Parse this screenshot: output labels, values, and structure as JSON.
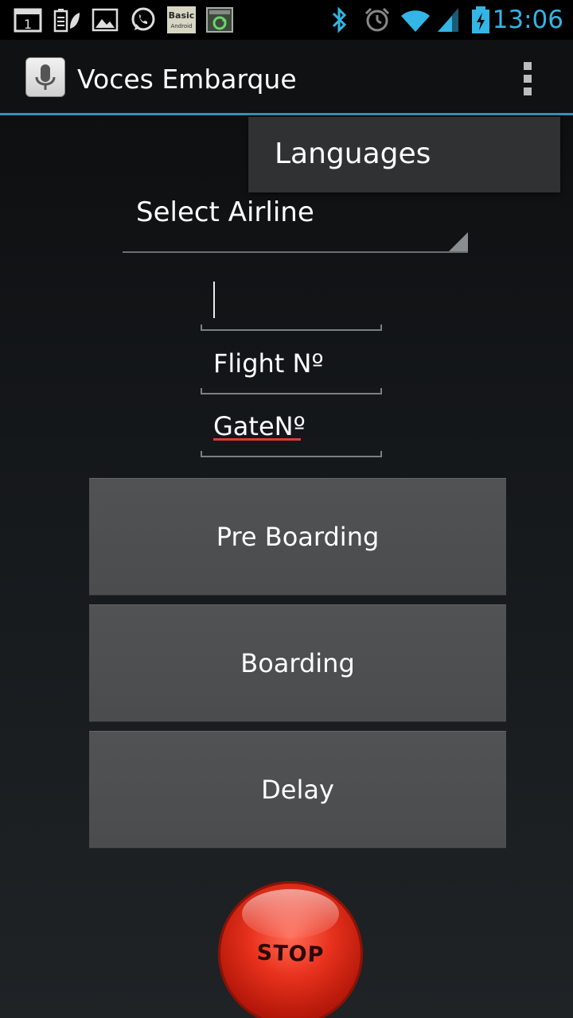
{
  "status_bar": {
    "time": "13:06",
    "left_icons": [
      "calendar-notification-icon",
      "battery-eco-icon",
      "gallery-icon",
      "whatsapp-icon",
      "basic4android-icon",
      "app-update-icon"
    ],
    "badge_calendar": "1",
    "badge_basic_line1": "Basic",
    "badge_basic_line2": "Android",
    "right_icons": [
      "bluetooth-icon",
      "alarm-icon",
      "wifi-icon",
      "signal-icon",
      "battery-charging-icon"
    ],
    "accent_color": "#33b5e5"
  },
  "action_bar": {
    "title": "Voces Embarque",
    "app_icon": "microphone-icon",
    "overflow_icon": "overflow-menu-icon"
  },
  "popup_menu": {
    "items": [
      "Languages"
    ]
  },
  "form": {
    "airline_spinner": "Select Airline",
    "text_input_value": "",
    "flight_field": "Flight Nº",
    "gate_field": "GateNº"
  },
  "buttons": {
    "pre_boarding": "Pre Boarding",
    "boarding": "Boarding",
    "delay": "Delay",
    "stop": "STOP"
  }
}
